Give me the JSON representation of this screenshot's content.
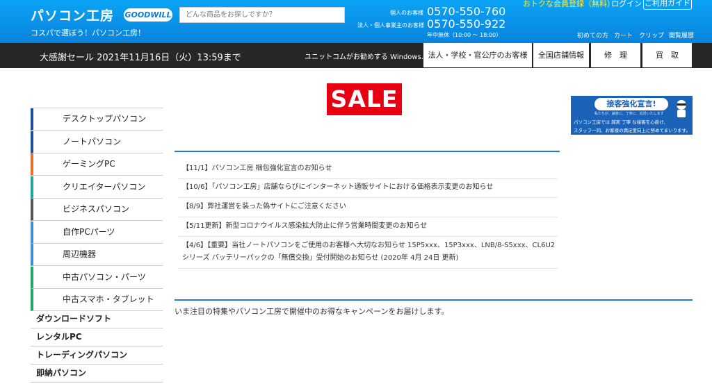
{
  "header": {
    "logo": "パソコン工房",
    "brand_badge": "GOODWILL",
    "tagline": "コスパで選ぼう！パソコン工房！",
    "search_placeholder": "どんな商品をお探しですか？",
    "personal_label": "個人のお客様",
    "personal_phone": "0570-550-760",
    "business_label": "法人・個人事業主のお客様",
    "business_phone": "0570-550-922",
    "hours": "年中無休（10:00 ～ 18:00）",
    "member_link": "おトクな会員登録（無料）",
    "login": "ログイン",
    "guide": "ご利用ガイド",
    "links": [
      "初めての方",
      "カート",
      "クリップ",
      "閲覧履歴"
    ]
  },
  "navbar": {
    "sale_text": "大感謝セール 2021年11月16日（火）13:59まで",
    "windows_text": "ユニットコムがお勧めする Windows.",
    "buttons": [
      "法人・学校・官公庁のお客様",
      "全国店舗情報",
      "修　理",
      "買　取"
    ]
  },
  "sale_badge": "SALE",
  "promo": {
    "title": "接客強化宣言!",
    "subtitle": "私たちが、誠意に、丁寧に、応対いたします",
    "line1": "パソコン工房では 誠実 丁寧 な接客を心掛け、",
    "line2": "スタッフ一同、お客様の満足度向上に努めてまいります。"
  },
  "sidebar": {
    "items": [
      {
        "label": "デスクトップパソコン",
        "color": "#1a4fa0"
      },
      {
        "label": "ノートパソコン",
        "color": "#1a4fa0"
      },
      {
        "label": "ゲーミングPC",
        "color": "#e8702a"
      },
      {
        "label": "クリエイターパソコン",
        "color": "#1fa89a"
      },
      {
        "label": "ビジネスパソコン",
        "color": "#555555"
      },
      {
        "label": "自作PCパーツ",
        "color": "#3a8fd8"
      },
      {
        "label": "周辺機器",
        "color": "#3a8fd8"
      },
      {
        "label": "中古パソコン・パーツ",
        "color": "#1fa86a"
      },
      {
        "label": "中古スマホ・タブレット",
        "color": "#1fa86a"
      }
    ],
    "plain_items": [
      "ダウンロードソフト",
      "レンタルPC",
      "トレーディングパソコン",
      "即納パソコン"
    ]
  },
  "news": [
    "【11/1】パソコン工房 梱包強化宣言のお知らせ",
    "【10/6】「パソコン工房」店舗ならびにインターネット通販サイトにおける価格表示変更のお知らせ",
    "【8/9】弊社運営を装った偽サイトにご注意ください",
    "【5/11更新】新型コロナウイルス感染拡大防止に伴う営業時間変更のお知らせ",
    "【4/6】【重要】当社ノートパソコンをご使用のお客様へ大切なお知らせ 15P5xxx、15P3xxx、LNB/8-S5xxx、CL6U2シリーズ バッテリーパックの「無償交換」受付開始のお知らせ (2020年 4月 24日 更新)"
  ],
  "featured_text": "いま注目の特集やパソコン工房で開催中のお得なキャンペーンをお届けします。"
}
